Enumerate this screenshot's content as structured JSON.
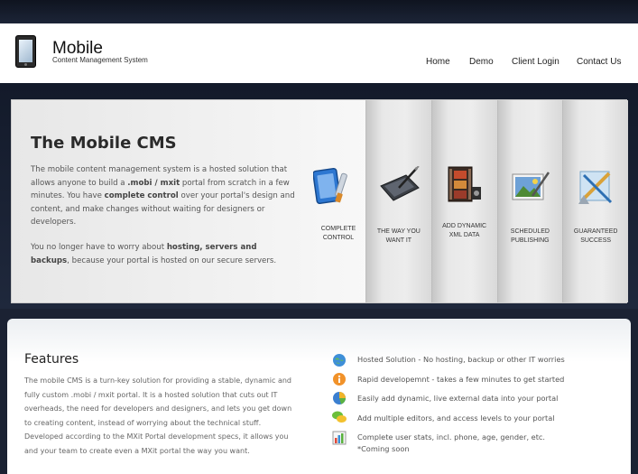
{
  "header": {
    "logo_title": "Mobile",
    "logo_subtitle": "Content Management System",
    "nav": [
      "Home",
      "Demo",
      "Client Login",
      "Contact Us"
    ]
  },
  "hero": {
    "title": "The Mobile CMS",
    "para1_line1": "The mobile content management system is a hosted solution that",
    "para1_line2a": "allows anyone to build a ",
    "para1_line2b": ".mobi / mxit",
    "para1_line2c": " portal from scratch in a few",
    "para1_line3a": "minutes. You have ",
    "para1_line3b": "complete control",
    "para1_line3c": " over your portal's design and",
    "para1_line4": "content, and make changes without waiting for designers or",
    "para1_line5": "developers.",
    "para2_line1a": "You no longer have to worry about ",
    "para2_line1b": "hosting, servers and",
    "para2_line2a": "backups",
    "para2_line2b": ", because your portal is hosted on our secure servers."
  },
  "features_strip": [
    {
      "label1": "COMPLETE",
      "label2": "CONTROL",
      "icon": "tablet-paint-icon"
    },
    {
      "label1": "THE WAY YOU",
      "label2": "WANT IT",
      "icon": "stylus-tablet-icon"
    },
    {
      "label1": "ADD DYNAMIC",
      "label2": "XML DATA",
      "icon": "film-strip-icon"
    },
    {
      "label1": "SCHEDULED",
      "label2": "PUBLISHING",
      "icon": "picture-pen-icon"
    },
    {
      "label1": "GUARANTEED",
      "label2": "SUCCESS",
      "icon": "drafting-tools-icon"
    }
  ],
  "features": {
    "title": "Features",
    "text": [
      "The mobile CMS is a turn-key solution for providing a stable, dynamic and",
      "fully custom .mobi / mxit portal. It is a hosted solution that cuts out IT",
      "overheads, the need for developers and designers, and lets you get down",
      "to creating content, instead of worrying about the technical stuff.",
      "Developed according to the MXit Portal development specs, it allows you",
      "and your team to create even a MXit portal the way you want."
    ],
    "bullets": [
      {
        "text": "Hosted Solution - No hosting, backup or other IT worries",
        "icon": "globe-icon"
      },
      {
        "text": "Rapid developemnt - takes a few minutes to get started",
        "icon": "info-icon"
      },
      {
        "text": "Easily add dynamic, live external data into your portal",
        "icon": "pie-chart-icon"
      },
      {
        "text": "Add multiple editors, and access levels to your portal",
        "icon": "chat-icon"
      },
      {
        "text": "Complete user stats, incl. phone, age, gender, etc.",
        "text2": "*Coming soon",
        "icon": "bar-chart-icon"
      }
    ]
  }
}
